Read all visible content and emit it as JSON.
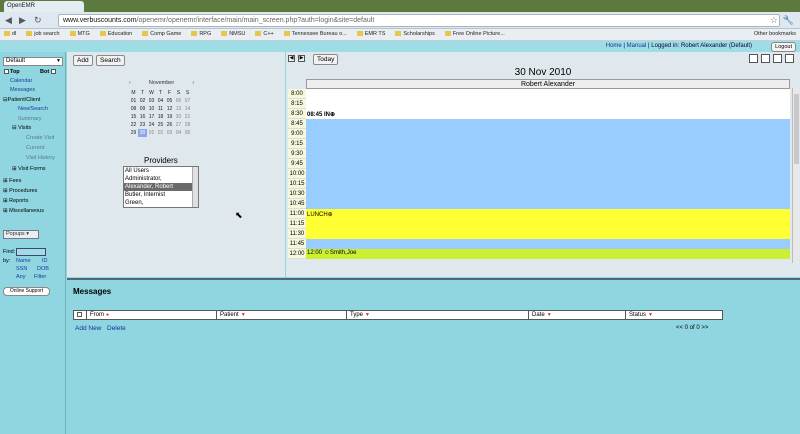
{
  "browser": {
    "tab_title": "OpenEMR",
    "url_host": "www.verbuscounts.com",
    "url_path": "/openemr/openemr/interface/main/main_screen.php?auth=login&site=default",
    "bookmarks": [
      "dl",
      "job search",
      "MTG",
      "Education",
      "Comp Game",
      "RPG",
      "NMSU",
      "C++",
      "Tennessee Bureau o...",
      "EMR TS",
      "Scholarships",
      "Free Online Picture..."
    ],
    "other_bookmarks": "Other bookmarks"
  },
  "top_bar": {
    "home": "Home",
    "manual": "Manual",
    "logged_in": "Logged in: Robert Alexander",
    "site": "(Default)",
    "logout": "Logout"
  },
  "left_nav": {
    "layout_select": "Default",
    "top_label": "Top",
    "bot_label": "Bot",
    "items": {
      "calendar": "Calendar",
      "messages": "Messages",
      "patient_client": "Patient/Client",
      "new_search": "New/Search",
      "summary": "Summary",
      "visits": "Visits",
      "create_visit": "Create Visit",
      "current": "Current",
      "visit_history": "Visit History",
      "visit_forms": "Visit Forms",
      "fees": "Fees",
      "procedures": "Procedures",
      "reports": "Reports",
      "miscellaneous": "Miscellaneous"
    },
    "popups": "Popups",
    "find_label": "Find:",
    "by_label": "by:",
    "name": "Name",
    "id": "ID",
    "ssn": "SSN",
    "dob": "DOB",
    "any": "Any",
    "filter": "Filter",
    "online_support": "Online Support"
  },
  "center": {
    "add": "Add",
    "search": "Search",
    "mini_month": "November",
    "day_heads": [
      "M",
      "T",
      "W",
      "T",
      "F",
      "S",
      "S"
    ],
    "weeks": [
      [
        "01",
        "02",
        "03",
        "04",
        "05",
        "06",
        "07"
      ],
      [
        "08",
        "09",
        "10",
        "11",
        "12",
        "13",
        "14"
      ],
      [
        "15",
        "16",
        "17",
        "18",
        "19",
        "20",
        "21"
      ],
      [
        "22",
        "23",
        "24",
        "25",
        "26",
        "27",
        "28"
      ],
      [
        "29",
        "30",
        "01",
        "02",
        "03",
        "04",
        "05"
      ]
    ],
    "providers_label": "Providers",
    "providers": [
      "All Users",
      "Administrator,",
      "Alexander, Robert",
      "Butler, Internist",
      "Green,"
    ]
  },
  "calendar": {
    "today_btn": "Today",
    "date_title": "30 Nov 2010",
    "provider_header": "Robert Alexander",
    "times": [
      "8:00",
      "8:15",
      "8:30",
      "8:45",
      "9:00",
      "9:15",
      "9:30",
      "9:45",
      "10:00",
      "10:15",
      "10:30",
      "10:45",
      "11:00",
      "11:15",
      "11:30",
      "11:45",
      "12:00"
    ],
    "events": {
      "in_event": "08:45 IN",
      "lunch": "LUNCH",
      "appt_time": "12:00",
      "appt_name": "Smith,Joe"
    },
    "colors": {
      "white": "#ffffff",
      "blue": "#99ccff",
      "yellow": "#ffff33",
      "lime": "#ccee33"
    }
  },
  "messages": {
    "title": "Messages",
    "columns": [
      "From",
      "Patient",
      "Type",
      "Date",
      "Status"
    ],
    "add_new": "Add New",
    "delete": "Delete",
    "pager": "<<  0 of 0  >>"
  }
}
